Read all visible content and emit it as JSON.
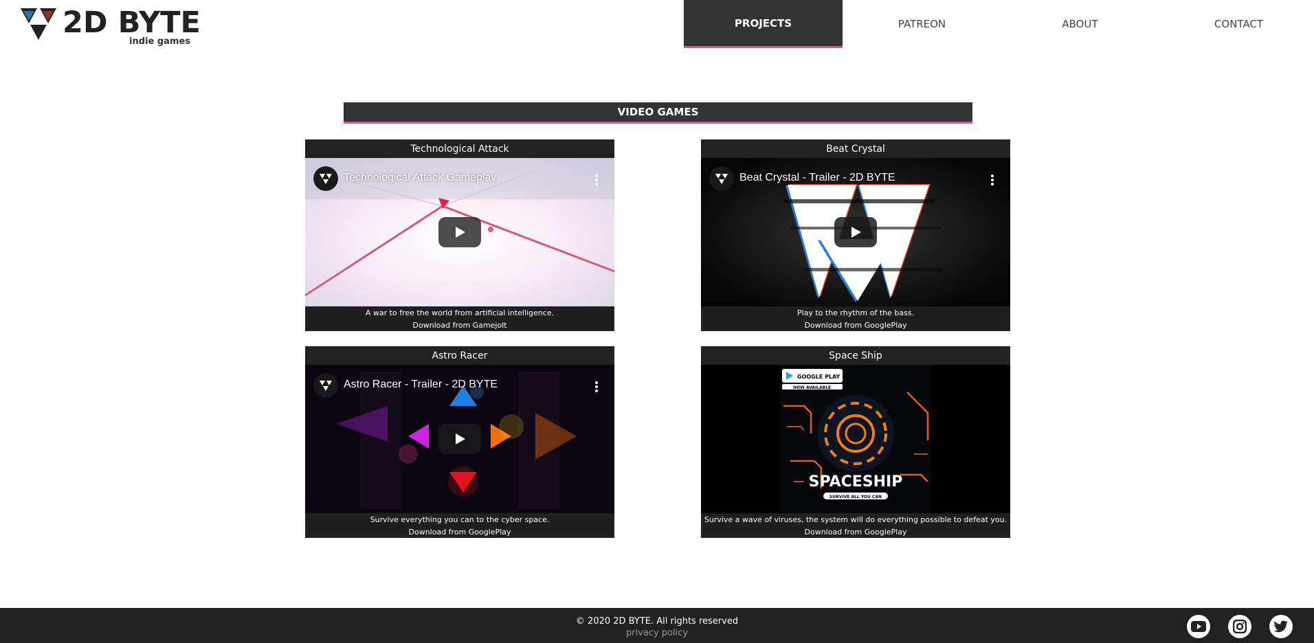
{
  "brand": {
    "name": "2D BYTE",
    "tagline": "indie games",
    "accent_color": "#ff3ca8",
    "dark_color": "#333333"
  },
  "nav": {
    "items": [
      {
        "label": "PROJECTS",
        "active": true
      },
      {
        "label": "PATREON",
        "active": false
      },
      {
        "label": "ABOUT",
        "active": false
      },
      {
        "label": "CONTACT",
        "active": false
      }
    ]
  },
  "section": {
    "title": "VIDEO GAMES"
  },
  "games": [
    {
      "title": "Technological Attack",
      "video_title": "Technological Attack Gameplay",
      "description": "A war to free the world from artificial intelligence.",
      "link": "Download from Gamejolt"
    },
    {
      "title": "Beat Crystal",
      "video_title": "Beat Crystal - Trailer - 2D BYTE",
      "description": "Play to the rhythm of the bass.",
      "link": "Download from GooglePlay"
    },
    {
      "title": "Astro Racer",
      "video_title": "Astro Racer - Trailer - 2D BYTE",
      "description": "Survive everything you can to the cyber space.",
      "link": "Download from GooglePlay"
    },
    {
      "title": "Space Ship",
      "description": "Survive a wave of viruses, the system will do everything possible to defeat you.",
      "link": "Download from GooglePlay",
      "image": {
        "badge_top": "GOOGLE PLAY",
        "badge_sub": "NOW AVAILABLE",
        "title": "SPACESHIP",
        "subtitle": "SURVIVE ALL YOU CAN"
      }
    }
  ],
  "footer": {
    "copyright": "© 2020 2D BYTE. All rights reserved",
    "privacy": "privacy policy",
    "social_icons": [
      "youtube-icon",
      "instagram-icon",
      "twitter-icon"
    ]
  }
}
